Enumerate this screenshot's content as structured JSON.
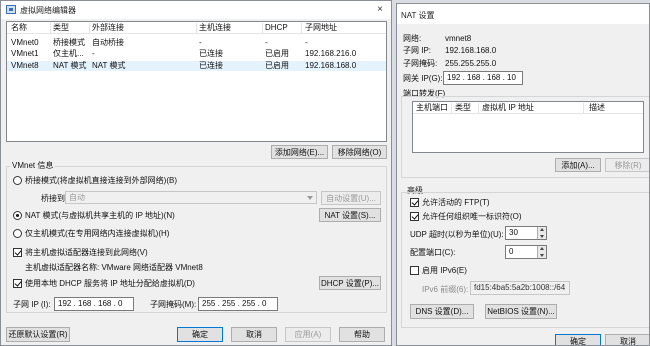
{
  "vne": {
    "title": "虚拟网络编辑器",
    "close": "×",
    "columns": [
      "名称",
      "类型",
      "外部连接",
      "主机连接",
      "DHCP",
      "子网地址"
    ],
    "rows": [
      {
        "name": "VMnet0",
        "type": "桥接模式",
        "ext": "自动桥接",
        "host": "-",
        "dhcp": "-",
        "subnet": "-"
      },
      {
        "name": "VMnet1",
        "type": "仅主机...",
        "ext": "-",
        "host": "已连接",
        "dhcp": "已启用",
        "subnet": "192.168.216.0"
      },
      {
        "name": "VMnet8",
        "type": "NAT 模式",
        "ext": "NAT 模式",
        "host": "已连接",
        "dhcp": "已启用",
        "subnet": "192.168.168.0"
      }
    ],
    "add_network": "添加网络(E)...",
    "remove_network": "移除网络(O)",
    "vmnet_info_title": "VMnet 信息",
    "bridge_mode": "桥接模式(将虚拟机直接连接到外部网络)(B)",
    "bridged_to_label": "桥接到(T):",
    "bridged_to_value": "自动",
    "auto_settings": "自动设置(U)...",
    "nat_mode": "NAT 模式(与虚拟机共享主机的 IP 地址)(N)",
    "nat_settings": "NAT 设置(S)...",
    "host_only": "仅主机模式(在专用网络内连接虚拟机)(H)",
    "connect_host_adapter": "将主机虚拟适配器连接到此网络(V)",
    "host_adapter_name": "主机虚拟适配器名称: VMware 网络适配器 VMnet8",
    "use_dhcp": "使用本地 DHCP 服务将 IP 地址分配给虚拟机(D)",
    "dhcp_settings": "DHCP 设置(P)...",
    "subnet_ip_label": "子网 IP (I):",
    "subnet_ip": "192 . 168 . 168 .  0",
    "subnet_mask_label": "子网掩码(M):",
    "subnet_mask": "255 . 255 . 255 .  0",
    "restore_defaults": "还原默认设置(R)",
    "ok": "确定",
    "cancel": "取消",
    "apply": "应用(A)",
    "help": "帮助"
  },
  "nat": {
    "title": "NAT 设置",
    "network_label": "网络:",
    "network_value": "vmnet8",
    "subnet_ip_label": "子网 IP:",
    "subnet_ip_value": "192.168.168.0",
    "subnet_mask_label": "子网掩码:",
    "subnet_mask_value": "255.255.255.0",
    "gateway_label": "网关 IP(G):",
    "gateway_value": "192 . 168 . 168 . 10",
    "port_forwarding_title": "端口转发(F)",
    "pf_columns": [
      "主机端口",
      "类型",
      "虚拟机 IP 地址",
      "描述"
    ],
    "add": "添加(A)...",
    "remove": "移除(R)",
    "advanced_title": "高级",
    "allow_active_ftp": "允许活动的 FTP(T)",
    "allow_any_oui": "允许任何组织唯一标识符(O)",
    "udp_timeout_label": "UDP 超时(以秒为单位)(U):",
    "udp_timeout_value": "30",
    "config_port_label": "配置端口(C):",
    "config_port_value": "0",
    "enable_ipv6": "启用 IPv6(E)",
    "ipv6_prefix_label": "IPv6 前缀(6):",
    "ipv6_prefix_value": "fd15:4ba5:5a2b:1008::/64",
    "dns_settings": "DNS 设置(D)...",
    "netbios_settings": "NetBIOS 设置(N)...",
    "ok": "确定",
    "cancel": "取消"
  }
}
